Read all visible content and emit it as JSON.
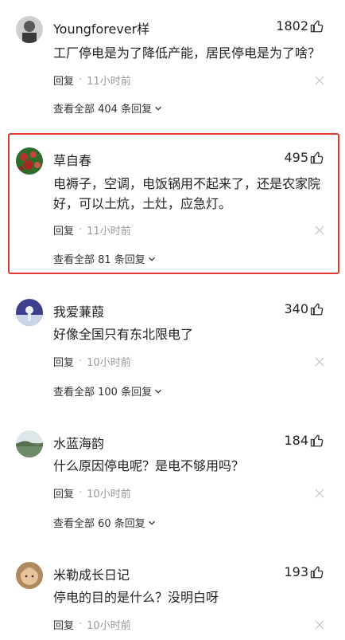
{
  "comments": [
    {
      "username": "Youngforever样",
      "likes": "1802",
      "text": "工厂停电是为了降低产能，居民停电是为了啥？",
      "reply_label": "回复",
      "separator": "·",
      "time": "11小时前",
      "view_all": "查看全部 404 条回复",
      "avatar_colors": [
        "#3a3a3a",
        "#8a8a8a"
      ]
    },
    {
      "username": "草自春",
      "likes": "495",
      "text": "电褥子，空调，电饭锅用不起来了，还是农家院好，可以土炕，土灶，应急灯。",
      "reply_label": "回复",
      "separator": "·",
      "time": "11小时前",
      "view_all": "查看全部 81 条回复",
      "avatar_colors": [
        "#2f6b2a",
        "#b4322c"
      ]
    },
    {
      "username": "我爱蒹葭",
      "likes": "340",
      "text": "好像全国只有东北限电了",
      "reply_label": "回复",
      "separator": "·",
      "time": "10小时前",
      "view_all": "查看全部 100 条回复",
      "avatar_colors": [
        "#3d3f8c",
        "#c9d6ea"
      ]
    },
    {
      "username": "水蓝海韵",
      "likes": "184",
      "text": "什么原因停电呢？是电不够用吗？",
      "reply_label": "回复",
      "separator": "·",
      "time": "10小时前",
      "view_all": "查看全部 60 条回复",
      "avatar_colors": [
        "#6f8a6a",
        "#dfe6ea"
      ]
    },
    {
      "username": "米勒成长日记",
      "likes": "193",
      "text": "停电的目的是什么？没明白呀",
      "reply_label": "回复",
      "separator": "·",
      "time": "10小时前",
      "avatar_colors": [
        "#c79a6b",
        "#6b4a2a"
      ]
    }
  ],
  "colors": {
    "highlight_border": "#e03b30",
    "meta": "#999999",
    "text": "#222222"
  },
  "icons": {
    "like": "thumbs-up-icon",
    "close": "close-icon",
    "expand": "chevron-down-icon"
  }
}
